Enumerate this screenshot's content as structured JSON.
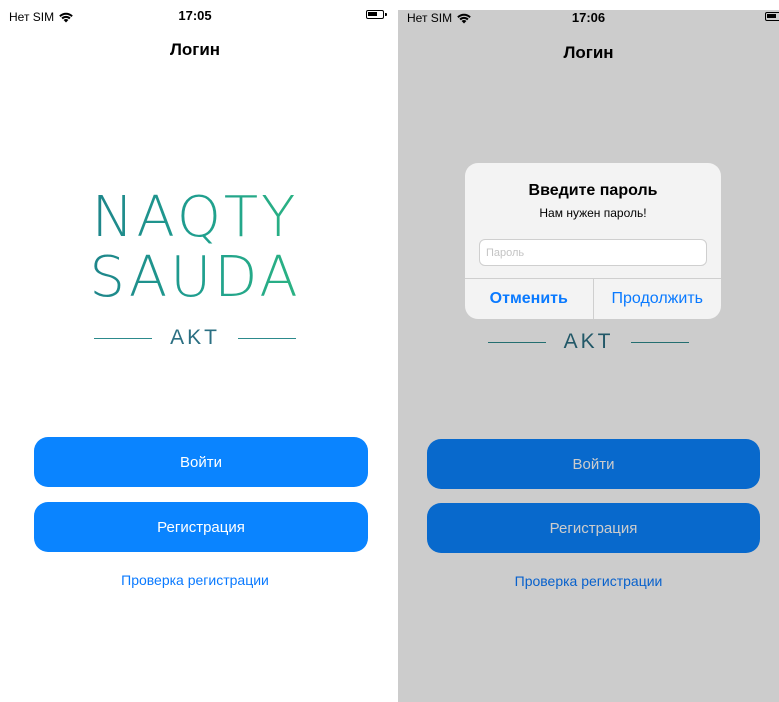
{
  "colors": {
    "accent": "#0a84ff",
    "link": "#0a7aff",
    "logo_gradient_start": "#1e6f86",
    "logo_gradient_end": "#35c478"
  },
  "screens": [
    {
      "status": {
        "carrier": "Нет SIM",
        "time": "17:05",
        "wifi_icon": "wifi-icon",
        "battery_icon": "battery-icon"
      },
      "nav_title": "Логин",
      "logo": {
        "line1": "NAQTY",
        "line2": "SAUDA",
        "tagline": "AKT"
      },
      "login_button": "Войти",
      "register_button": "Регистрация",
      "check_link": "Проверка регистрации"
    },
    {
      "status": {
        "carrier": "Нет SIM",
        "time": "17:06",
        "wifi_icon": "wifi-icon",
        "battery_icon": "battery-icon"
      },
      "nav_title": "Логин",
      "logo": {
        "tagline": "AKT"
      },
      "login_button": "Войти",
      "register_button": "Регистрация",
      "check_link": "Проверка регистрации",
      "alert": {
        "title": "Введите пароль",
        "message": "Нам нужен пароль!",
        "input_placeholder": "Пароль",
        "input_value": "",
        "cancel_button": "Отменить",
        "continue_button": "Продолжить"
      }
    }
  ]
}
